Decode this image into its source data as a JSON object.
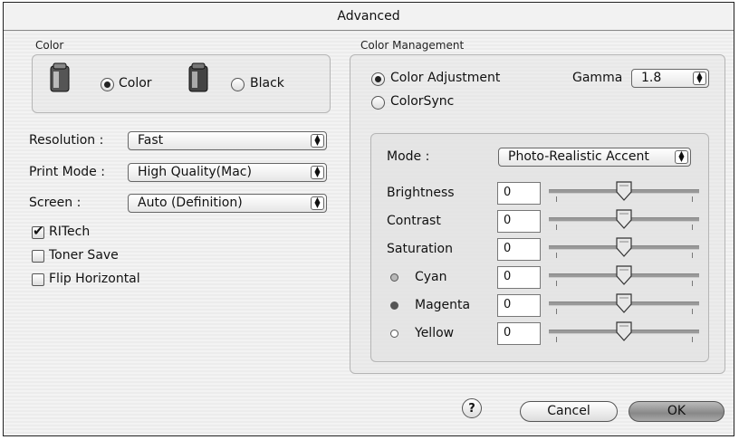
{
  "window": {
    "title": "Advanced"
  },
  "color_group": {
    "label": "Color",
    "options": [
      {
        "label": "Color",
        "selected": true
      },
      {
        "label": "Black",
        "selected": false
      }
    ]
  },
  "settings": [
    {
      "label": "Resolution :",
      "value": "Fast"
    },
    {
      "label": "Print Mode :",
      "value": "High Quality(Mac)"
    },
    {
      "label": "Screen :",
      "value": "Auto (Definition)"
    }
  ],
  "checkboxes": [
    {
      "label": "RITech",
      "checked": true
    },
    {
      "label": "Toner Save",
      "checked": false
    },
    {
      "label": "Flip Horizontal",
      "checked": false
    }
  ],
  "color_management": {
    "label": "Color Management",
    "options": [
      {
        "label": "Color Adjustment",
        "selected": true
      },
      {
        "label": "ColorSync",
        "selected": false
      }
    ],
    "gamma_label": "Gamma",
    "gamma_value": "1.8",
    "mode_label": "Mode :",
    "mode_value": "Photo-Realistic Accent",
    "adjustments": [
      {
        "label": "Brightness",
        "value": "0",
        "level": 0.5
      },
      {
        "label": "Contrast",
        "value": "0",
        "level": 0.5
      },
      {
        "label": "Saturation",
        "value": "0",
        "level": 0.5
      },
      {
        "label": "Cyan",
        "value": "0",
        "level": 0.5,
        "dot_color": "#b8b8b8"
      },
      {
        "label": "Magenta",
        "value": "0",
        "level": 0.5,
        "dot_color": "#555555"
      },
      {
        "label": "Yellow",
        "value": "0",
        "level": 0.5,
        "dot_color": "#ffffff"
      }
    ]
  },
  "buttons": {
    "help": "?",
    "cancel": "Cancel",
    "ok": "OK"
  }
}
